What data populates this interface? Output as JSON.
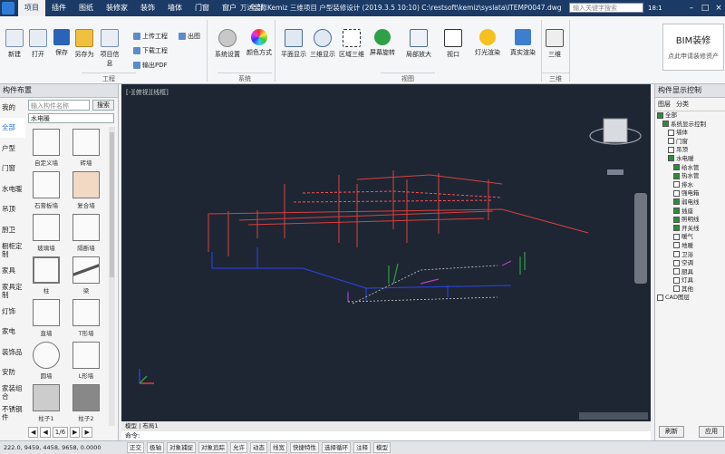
{
  "titlebar": {
    "menu": [
      "项目",
      "插件",
      "图纸",
      "装修家",
      "装饰",
      "墙体",
      "门窗",
      "窗户",
      "全部"
    ],
    "title": "万达装修Kemiz 三维项目 户型装修设计 (2019.3.5 10:10)  C:\\restsoft\\kemiz\\syslata\\ITEMP0047.dwg",
    "search_placeholder": "输入关键字搜索",
    "user": "18:1"
  },
  "ribbon": {
    "buttons": [
      "新建",
      "打开",
      "保存",
      "另存为",
      "项目信息"
    ],
    "small_buttons": [
      "上传工程",
      "下载工程",
      "输出PDF",
      "出图"
    ],
    "view_buttons": [
      "系统设置",
      "颜色方式"
    ],
    "display_buttons": [
      "平面显示",
      "三维显示",
      "区域三维",
      "屏幕旋转",
      "局部放大",
      "视口",
      "灯光渲染",
      "效果图渲染",
      "真实渲染"
    ],
    "cube_label": "三维",
    "groups": [
      "工程",
      "系统",
      "视图",
      "三维"
    ],
    "bim_title": "BIM装修",
    "bim_sub": "点此申请装修资产"
  },
  "left_panel": {
    "header": "构件布置",
    "categories": [
      "我的",
      "全部",
      "户型",
      "门窗",
      "水电暖",
      "吊顶",
      "厨卫",
      "橱柜定制",
      "家具",
      "家具定制",
      "灯饰",
      "家电",
      "装饰品",
      "安防",
      "家装组合",
      "不锈钢件"
    ],
    "search_placeholder": "输入构件名称",
    "search_button": "搜索",
    "dropdown": "水电暖",
    "tiles": [
      "自定义墙",
      "砖墙",
      "石膏板墙",
      "复合墙",
      "玻璃墙",
      "隔断墙",
      "柱",
      "梁",
      "直墙",
      "T形墙",
      "圆墙",
      "L形墙",
      "柱子1",
      "柱子2"
    ],
    "pager": [
      "◀",
      "◀",
      "1/6",
      "▶",
      "▶"
    ]
  },
  "viewport": {
    "label": "[-][俯视][线框]",
    "tabs": "模型 | 布局1",
    "command": "命令:"
  },
  "right_panel": {
    "header": "构件显示控制",
    "tabs": [
      "图层",
      "分类"
    ],
    "tree": [
      {
        "label": "全部",
        "depth": 0,
        "on": true
      },
      {
        "label": "系统显示控制",
        "depth": 1,
        "on": true
      },
      {
        "label": "墙体",
        "depth": 2,
        "on": false
      },
      {
        "label": "门窗",
        "depth": 2,
        "on": false
      },
      {
        "label": "吊顶",
        "depth": 2,
        "on": false
      },
      {
        "label": "水电暖",
        "depth": 2,
        "on": true
      },
      {
        "label": "给水管",
        "depth": 3,
        "on": true
      },
      {
        "label": "热水管",
        "depth": 3,
        "on": true
      },
      {
        "label": "排水",
        "depth": 3,
        "on": false
      },
      {
        "label": "强电箱",
        "depth": 3,
        "on": false
      },
      {
        "label": "弱电线",
        "depth": 3,
        "on": true
      },
      {
        "label": "插座",
        "depth": 3,
        "on": true
      },
      {
        "label": "照明线",
        "depth": 3,
        "on": true
      },
      {
        "label": "开关线",
        "depth": 3,
        "on": true
      },
      {
        "label": "暖气",
        "depth": 3,
        "on": false
      },
      {
        "label": "地暖",
        "depth": 3,
        "on": false
      },
      {
        "label": "卫浴",
        "depth": 3,
        "on": false
      },
      {
        "label": "空调",
        "depth": 3,
        "on": false
      },
      {
        "label": "厨具",
        "depth": 3,
        "on": false
      },
      {
        "label": "灯具",
        "depth": 3,
        "on": false
      },
      {
        "label": "其他",
        "depth": 3,
        "on": false
      },
      {
        "label": "CAD图层",
        "depth": 0,
        "on": false
      }
    ],
    "buttons": [
      "刷新",
      "应用"
    ]
  },
  "status": {
    "coords": "222.0, 9459, 4458, 9658, 0.0000",
    "items": [
      "正交",
      "极轴",
      "对象捕捉",
      "对象追踪",
      "允许",
      "动态",
      "线宽",
      "快捷特性",
      "选择循环",
      "注释",
      "模型"
    ]
  }
}
